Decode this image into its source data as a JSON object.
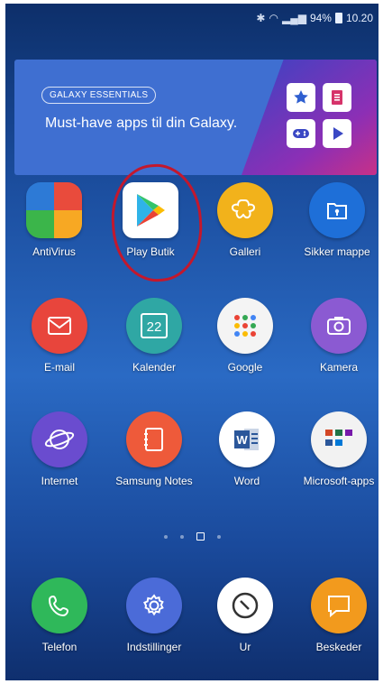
{
  "status": {
    "signal_text": "94%",
    "time": "10.20"
  },
  "banner": {
    "tag": "GALAXY ESSENTIALS",
    "headline": "Must-have apps til din Galaxy."
  },
  "apps": [
    {
      "label": "AntiVirus",
      "icon": "antivirus-icon"
    },
    {
      "label": "Play Butik",
      "icon": "play-store-icon"
    },
    {
      "label": "Galleri",
      "icon": "gallery-icon"
    },
    {
      "label": "Sikker mappe",
      "icon": "secure-folder-icon"
    },
    {
      "label": "E-mail",
      "icon": "email-icon"
    },
    {
      "label": "Kalender",
      "icon": "calendar-icon"
    },
    {
      "label": "Google",
      "icon": "google-folder-icon"
    },
    {
      "label": "Kamera",
      "icon": "camera-icon"
    },
    {
      "label": "Internet",
      "icon": "internet-icon"
    },
    {
      "label": "Samsung Notes",
      "icon": "notes-icon"
    },
    {
      "label": "Word",
      "icon": "word-icon"
    },
    {
      "label": "Microsoft-apps",
      "icon": "microsoft-folder-icon"
    }
  ],
  "calendar_day": "22",
  "dock": [
    {
      "label": "Telefon",
      "icon": "phone-icon"
    },
    {
      "label": "Indstillinger",
      "icon": "settings-icon"
    },
    {
      "label": "Ur",
      "icon": "clock-icon"
    },
    {
      "label": "Beskeder",
      "icon": "messages-icon"
    }
  ]
}
